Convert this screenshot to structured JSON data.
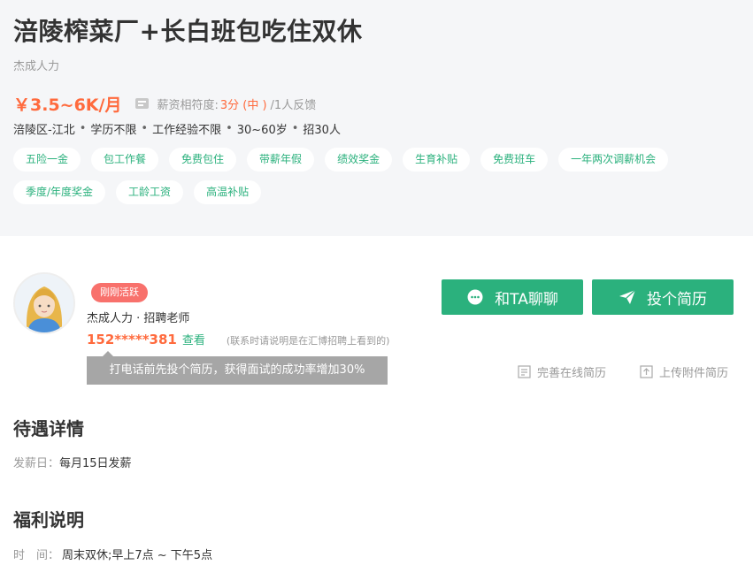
{
  "job": {
    "title": "涪陵榨菜厂+长白班包吃住双休",
    "company": "杰成人力",
    "salary": "￥3.5~6K/月",
    "feedback_label": "薪资相符度:",
    "feedback_score": "3分 (中 )",
    "feedback_count": "/1人反馈",
    "requirements": [
      "涪陵区-江北",
      "学历不限",
      "工作经验不限",
      "30~60岁",
      "招30人"
    ],
    "tags_row1": [
      "五险一金",
      "包工作餐",
      "免费包住",
      "带薪年假",
      "绩效奖金",
      "生育补贴",
      "免费班车",
      "一年两次调薪机会"
    ],
    "tags_row2": [
      "季度/年度奖金",
      "工龄工资",
      "高温补贴"
    ]
  },
  "recruiter": {
    "badge": "刚刚活跃",
    "name": "杰成人力 · 招聘老师",
    "phone": "152*****381",
    "view_label": "查看",
    "contact_note": "(联系时请说明是在汇博招聘上看到的)",
    "tooltip": "打电话前先投个简历，获得面试的成功率增加30%"
  },
  "actions": {
    "chat_label": "和TA聊聊",
    "resume_label": "投个简历",
    "online_resume": "完善在线简历",
    "upload_resume": "上传附件简历"
  },
  "benefit_section": {
    "title": "待遇详情",
    "pay_label": "发薪日：",
    "pay_value": "每月15日发薪"
  },
  "welfare_section": {
    "title": "福利说明",
    "time_label": "时　间：",
    "time_value": "周末双休;早上7点 ~ 下午5点"
  },
  "colors": {
    "accent_green": "#2bb17d",
    "salary_orange": "#ff6a3d",
    "badge_red": "#f8716c",
    "header_bg": "#f5f6f8"
  },
  "icons": [
    "feedback-icon",
    "chat-bubble-icon",
    "send-icon",
    "document-icon",
    "upload-icon"
  ]
}
